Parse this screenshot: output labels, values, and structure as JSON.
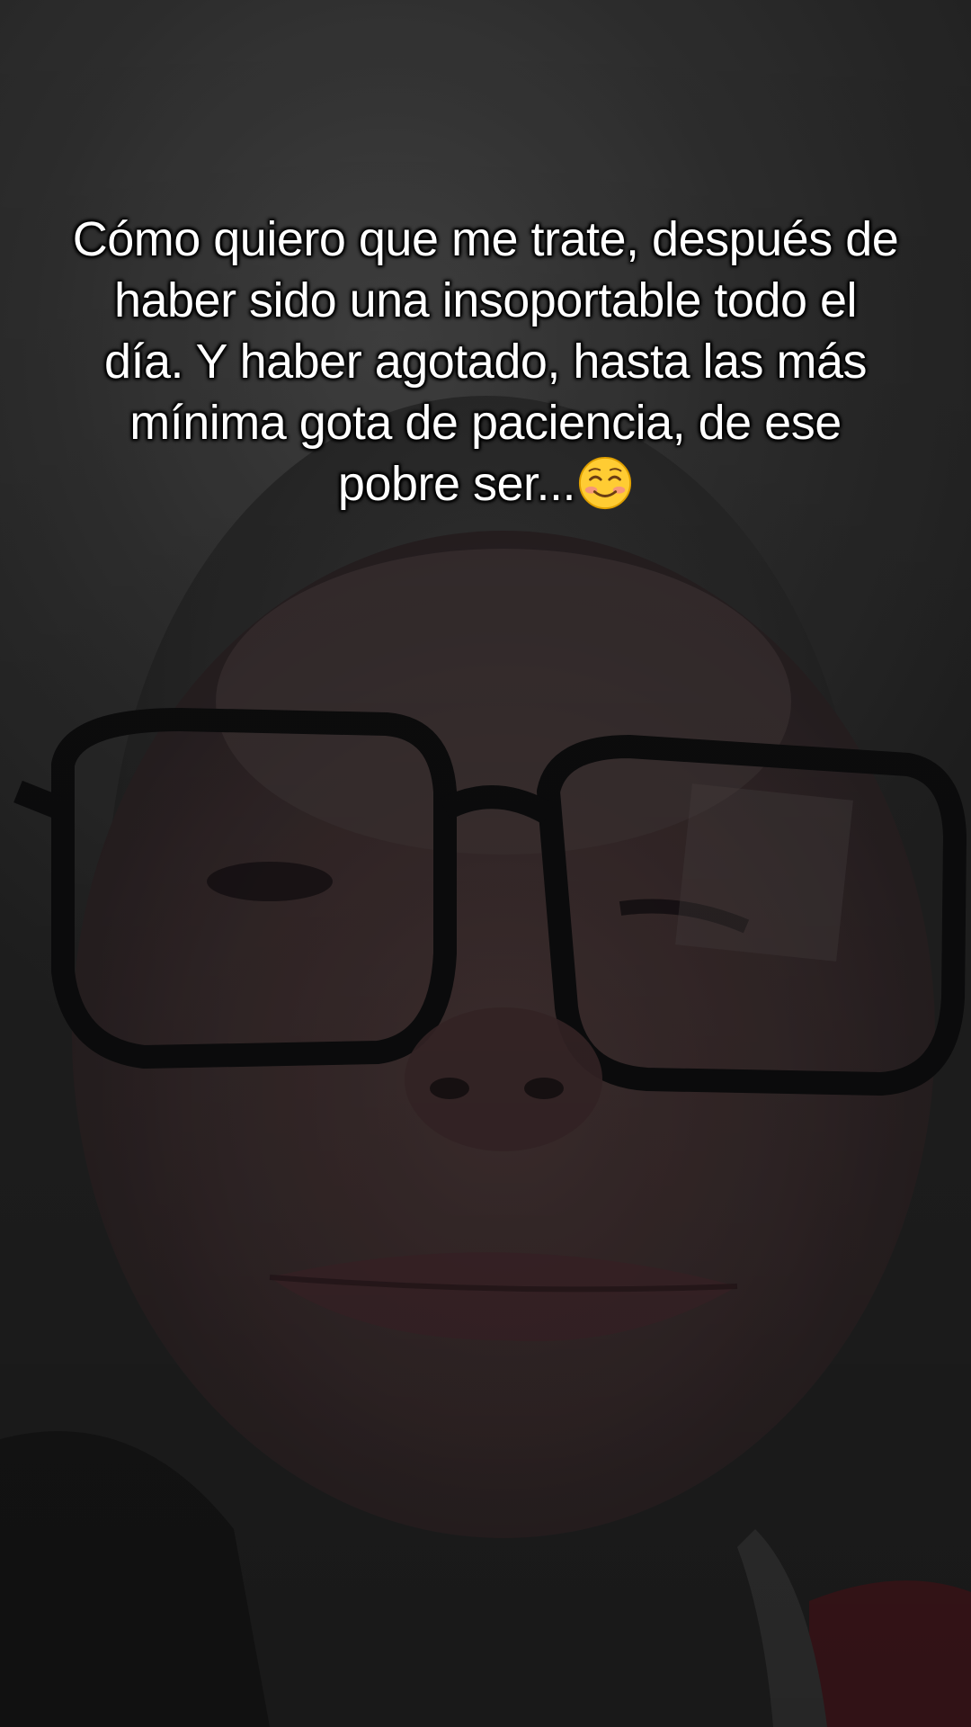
{
  "caption": {
    "text": "Cómo quiero que me trate, después de\nhaber sido una insoportable todo el\ndía.  Y haber agotado, hasta las más\nmínima gota de paciencia, de ese\npobre ser...",
    "emoji": "smiling-face-with-smiling-eyes-emoji"
  },
  "colors": {
    "caption_text": "#ffffff",
    "caption_outline": "#000000",
    "background": "#2a2a2a"
  }
}
